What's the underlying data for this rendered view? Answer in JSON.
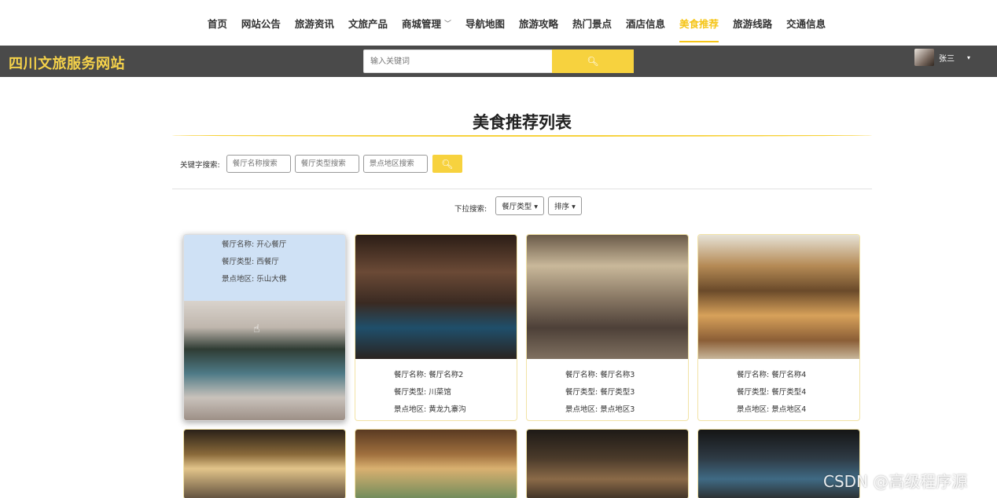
{
  "nav": {
    "items": [
      "首页",
      "网站公告",
      "旅游资讯",
      "文旅产品",
      "商城管理",
      "导航地图",
      "旅游攻略",
      "热门景点",
      "酒店信息",
      "美食推荐",
      "旅游线路",
      "交通信息"
    ],
    "active": "美食推荐"
  },
  "header": {
    "logo": "四川文旅服务网站",
    "search_placeholder": "输入关键词",
    "username": "张三"
  },
  "page": {
    "title": "美食推荐列表",
    "keyword_label": "关键字搜索:",
    "keyword_placeholders": [
      "餐厅名称搜索",
      "餐厅类型搜索",
      "景点地区搜索"
    ],
    "dropdown_label": "下拉搜索:",
    "dropdown_type": "餐厅类型",
    "dropdown_sort": "排序"
  },
  "cards": [
    {
      "name_label": "餐厅名称:",
      "name": "开心餐厅",
      "type_label": "餐厅类型:",
      "type": "西餐厅",
      "area_label": "景点地区:",
      "area": "乐山大佛"
    },
    {
      "name_label": "餐厅名称:",
      "name": "餐厅名称2",
      "type_label": "餐厅类型:",
      "type": "川菜馆",
      "area_label": "景点地区:",
      "area": "黄龙九寨沟"
    },
    {
      "name_label": "餐厅名称:",
      "name": "餐厅名称3",
      "type_label": "餐厅类型:",
      "type": "餐厅类型3",
      "area_label": "景点地区:",
      "area": "景点地区3"
    },
    {
      "name_label": "餐厅名称:",
      "name": "餐厅名称4",
      "type_label": "餐厅类型:",
      "type": "餐厅类型4",
      "area_label": "景点地区:",
      "area": "景点地区4"
    }
  ],
  "watermark": "CSDN @高级程序源",
  "colors": {
    "accent": "#f7d23e",
    "bar": "#4a4a4a",
    "hover_info_bg": "#cfe1f5"
  }
}
